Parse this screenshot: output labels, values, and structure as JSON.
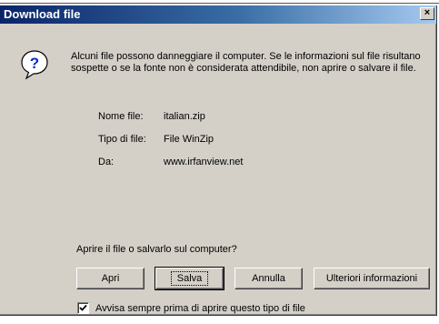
{
  "window": {
    "title": "Download file",
    "close_glyph": "×"
  },
  "message": {
    "icon": "question-icon",
    "text": "Alcuni file possono danneggiare il computer. Se le informazioni sul file risultano sospette o se la fonte non è considerata attendibile, non aprire o salvare il file."
  },
  "file_info": {
    "name_label": "Nome file:",
    "name_value": "italian.zip",
    "type_label": "Tipo di file:",
    "type_value": "File WinZip",
    "from_label": "Da:",
    "from_value": "www.irfanview.net"
  },
  "question": "Aprire il file o salvarlo sul computer?",
  "buttons": {
    "open": "Apri",
    "save": "Salva",
    "cancel": "Annulla",
    "more_info": "Ulteriori informazioni"
  },
  "checkbox": {
    "label": "Avvisa sempre prima di aprire questo tipo di file",
    "checked": true
  },
  "colors": {
    "titlebar_start": "#0a246a",
    "titlebar_end": "#a6caf0",
    "face": "#d4d0c8"
  }
}
